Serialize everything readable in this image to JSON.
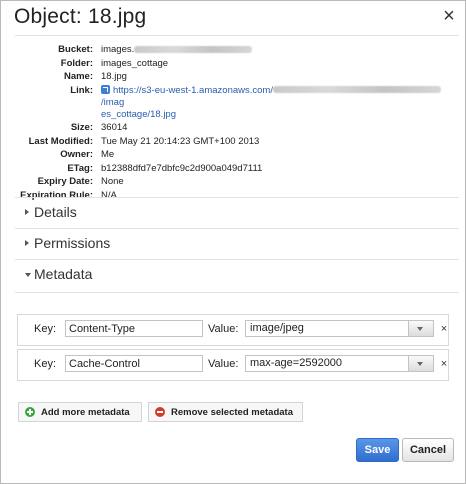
{
  "dialog": {
    "title": "Object: 18.jpg",
    "close_label": "×"
  },
  "properties": [
    {
      "key": "Bucket:",
      "value": "images."
    },
    {
      "key": "Folder:",
      "value": "images_cottage"
    },
    {
      "key": "Name:",
      "value": "18.jpg"
    },
    {
      "key": "Link:",
      "value_line1_start": "https://s3-eu-west-1.amazonaws.com/",
      "value_line1_end": "/imag",
      "value_line2": "es_cottage/18.jpg"
    },
    {
      "key": "Size:",
      "value": "36014"
    },
    {
      "key": "Last Modified:",
      "value": "Tue May 21 20:14:23 GMT+100 2013"
    },
    {
      "key": "Owner:",
      "value": "Me"
    },
    {
      "key": "ETag:",
      "value": "b12388dfd7e7dbfc9c2d900a049d7111"
    },
    {
      "key": "Expiry Date:",
      "value": "None"
    },
    {
      "key": "Expiration Rule:",
      "value": "N/A"
    }
  ],
  "sections": [
    {
      "label": "Details",
      "expanded": false
    },
    {
      "label": "Permissions",
      "expanded": false
    },
    {
      "label": "Metadata",
      "expanded": true
    }
  ],
  "metadata": {
    "key_label": "Key:",
    "value_label": "Value:",
    "remove_label": "×",
    "rows": [
      {
        "key": "Content-Type",
        "value": "image/jpeg"
      },
      {
        "key": "Cache-Control",
        "value": "max-age=2592000"
      }
    ],
    "add_label": "Add more metadata",
    "remove_selected_label": "Remove selected metadata"
  },
  "footer": {
    "save_label": "Save",
    "cancel_label": "Cancel"
  },
  "colors": {
    "accent": "#2f6dd0",
    "link": "#2a5db0",
    "add_icon": "#3aa53a",
    "remove_icon": "#d33b2c"
  },
  "icons": {
    "close": "close-icon",
    "link": "link-icon",
    "add": "plus-circle-icon",
    "remove": "minus-circle-icon",
    "dropdown": "chevron-down-icon"
  }
}
